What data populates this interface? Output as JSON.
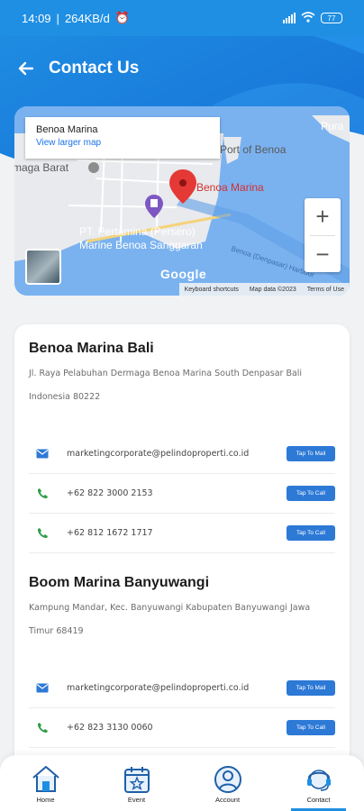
{
  "status_bar": {
    "time": "14:09",
    "net": "264KB/d",
    "battery": "77"
  },
  "header": {
    "title": "Contact Us"
  },
  "map": {
    "place_name": "Benoa Marina",
    "view_larger": "View larger map",
    "labels": [
      "Port of Benoa",
      "Pura",
      "maga Barat",
      "Benoa Marina",
      "PT. Pertamina (Persero)",
      "Marine Benoa Sanggaran",
      "Benoa (Denpasar) Harbour"
    ],
    "zoom_in": "+",
    "zoom_out": "−",
    "brand": "Google",
    "footer": [
      "Keyboard shortcuts",
      "Map data ©2023",
      "Terms of Use"
    ]
  },
  "locations": [
    {
      "name": "Benoa Marina Bali",
      "address": "Jl. Raya Pelabuhan Dermaga Benoa Marina South Denpasar Bali Indonesia 80222",
      "contacts": [
        {
          "icon": "mail-icon",
          "value": "marketingcorporate@pelindoproperti.co.id",
          "action": "Tap To Mail"
        },
        {
          "icon": "phone-icon",
          "value": "+62 822 3000 2153",
          "action": "Tap To Call"
        },
        {
          "icon": "phone-icon",
          "value": "+62 812 1672 1717",
          "action": "Tap To Call"
        }
      ]
    },
    {
      "name": "Boom Marina Banyuwangi",
      "address": "Kampung Mandar, Kec. Banyuwangi Kabupaten Banyuwangi Jawa Timur 68419",
      "contacts": [
        {
          "icon": "mail-icon",
          "value": "marketingcorporate@pelindoproperti.co.id",
          "action": "Tap To Mail"
        },
        {
          "icon": "phone-icon",
          "value": "+62 823 3130 0060",
          "action": "Tap To Call"
        }
      ]
    }
  ],
  "nav": [
    {
      "label": "Home",
      "icon": "home-icon"
    },
    {
      "label": "Event",
      "icon": "calendar-star-icon"
    },
    {
      "label": "Account",
      "icon": "account-icon"
    },
    {
      "label": "Contact",
      "icon": "headset-icon",
      "active": true
    }
  ],
  "colors": {
    "primary": "#1f8fe3",
    "button": "#2d79d6",
    "icon_green": "#2e9e48"
  }
}
